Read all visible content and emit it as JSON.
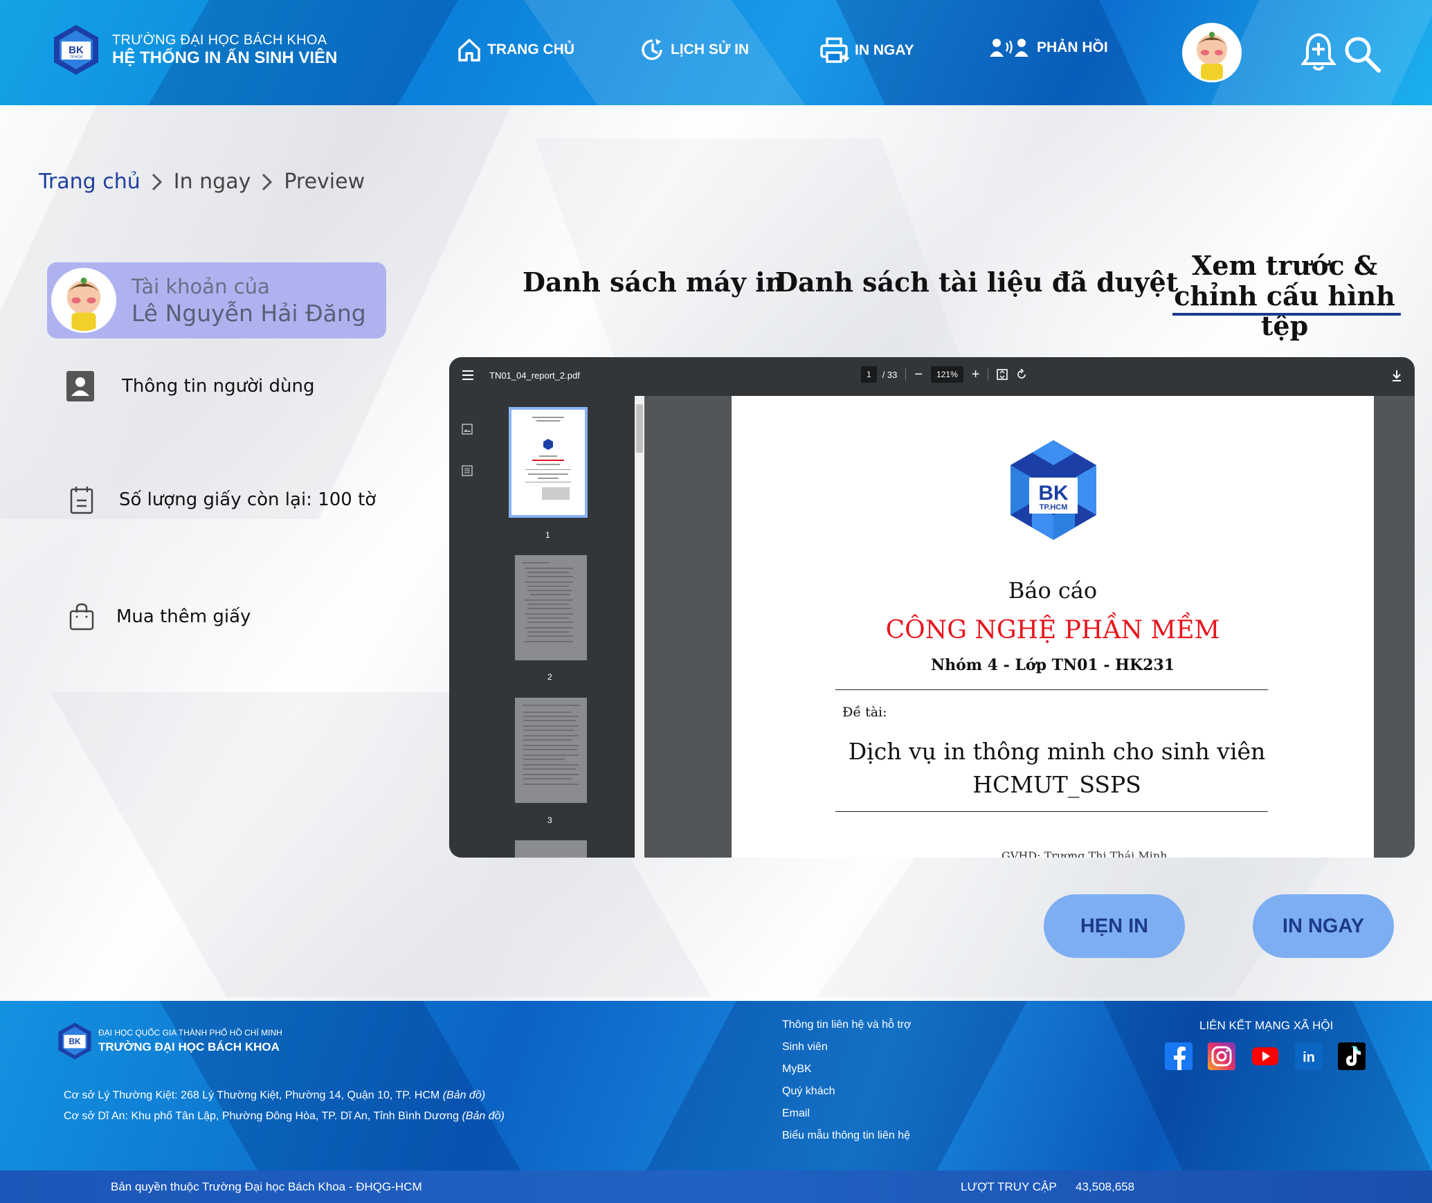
{
  "header": {
    "brand_top": "TRƯỜNG ĐẠI HỌC BÁCH KHOA",
    "brand_bottom": "HỆ THỐNG IN ẤN SINH VIÊN",
    "logo_text": "BK",
    "logo_sub": "TP.HCM",
    "nav": [
      {
        "label": "TRANG CHỦ",
        "icon": "home-icon"
      },
      {
        "label": "LỊCH SỬ IN",
        "icon": "history-icon"
      },
      {
        "label": "IN NGAY",
        "icon": "printer-icon"
      },
      {
        "label": "PHẢN HỒI",
        "icon": "feedback-icon"
      }
    ]
  },
  "breadcrumb": {
    "items": [
      "Trang chủ",
      "In ngay",
      "Preview"
    ],
    "separator": ">"
  },
  "sidebar": {
    "account_label": "Tài khoản của",
    "account_name": "Lê Nguyễn Hải Đăng",
    "items": [
      {
        "label": "Thông tin người dùng",
        "icon": "user-icon"
      },
      {
        "label": "Số lượng giấy còn lại: 100 tờ",
        "icon": "calendar-icon"
      },
      {
        "label": "Mua thêm giấy",
        "icon": "shopping-bag-icon"
      }
    ]
  },
  "tabs": {
    "printers": "Danh sách máy in",
    "approved_docs": "Danh sách tài liệu đã duyệt",
    "preview_line1": "Xem trước &",
    "preview_line2": "chỉnh cấu hình tệp"
  },
  "viewer": {
    "file_name": "TN01_04_report_2.pdf",
    "current_page": "1",
    "total_pages": "/ 33",
    "zoom": "121%",
    "thumbnails": [
      "1",
      "2",
      "3"
    ],
    "document": {
      "logo_text": "BK",
      "logo_sub": "TP.HCM",
      "title": "Báo cáo",
      "course": "CÔNG NGHỆ PHẦN MỀM",
      "group": "Nhóm 4 - Lớp TN01 - HK231",
      "topic_label": "Đề tài:",
      "topic_line1": "Dịch vụ in thông minh cho sinh viên",
      "topic_line2": "HCMUT_SSPS",
      "gvhd": "GVHD:   Trương Thị Thái Minh"
    }
  },
  "buttons": {
    "schedule": "HẸN IN",
    "print_now": "IN NGAY"
  },
  "footer": {
    "brand_top": "ĐẠI HỌC QUỐC GIA THÀNH PHỐ HỒ CHÍ MINH",
    "brand_bottom": "TRƯỜNG ĐẠI HỌC BÁCH KHOA",
    "address1": "Cơ sở Lý Thường Kiệt: 268 Lý Thường Kiệt, Phường 14, Quận 10, TP. HCM",
    "address2": "Cơ sở Dĩ An: Khu phố Tân Lập, Phường Đông Hòa, TP. Dĩ An, Tỉnh Bình Dương",
    "map_link": "(Bản đồ)",
    "links": [
      "Thông tin liên hệ và hỗ trợ",
      "Sinh viên",
      "MyBK",
      "Quý khách",
      "Email",
      "Biểu mẫu thông tin liên hệ"
    ],
    "social_title": "LIÊN KẾT MẠNG XÃ HỘI",
    "social": [
      "facebook-icon",
      "instagram-icon",
      "youtube-icon",
      "linkedin-icon",
      "tiktok-icon"
    ],
    "copyright": "Bản quyền thuộc Trường Đại học Bách Khoa - ĐHQG-HCM",
    "visits_label": "LƯỢT TRUY CẬP",
    "visits": "43,508,658"
  },
  "colors": {
    "header_blue": "#0b7fd9",
    "button_blue": "#7eaef2",
    "breadcrumb_link": "#1f3f9e",
    "account_card": "#aeb3f0",
    "course_red": "#e8141c"
  }
}
